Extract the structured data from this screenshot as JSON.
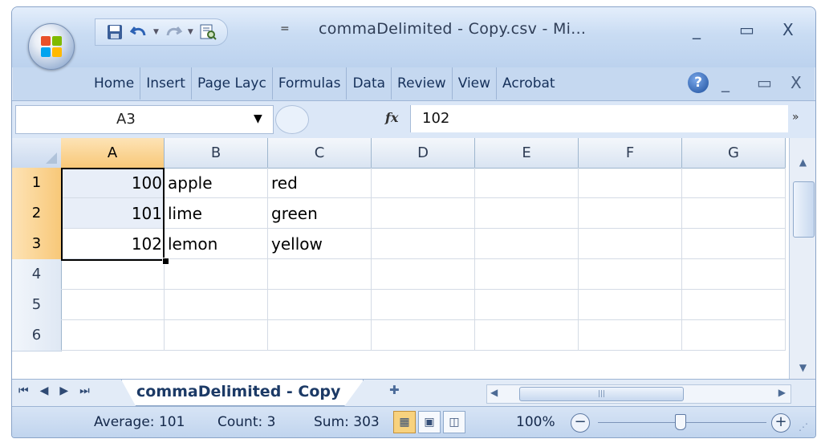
{
  "window": {
    "title": "commaDelimited - Copy.csv - Mi...",
    "minimize": "_",
    "restore": "▭",
    "close": "X"
  },
  "quick_access": {
    "more": "="
  },
  "menubar": {
    "items": [
      "Home",
      "Insert",
      "Page Layc",
      "Formulas",
      "Data",
      "Review",
      "View",
      "Acrobat"
    ],
    "help": "?",
    "minimize": "_",
    "restore": "▭",
    "close": "X"
  },
  "formula_bar": {
    "name_box": "A3",
    "fx_label": "fx",
    "value": "102"
  },
  "sheet": {
    "columns": [
      "A",
      "B",
      "C",
      "D",
      "E",
      "F",
      "G"
    ],
    "rows": [
      "1",
      "2",
      "3",
      "4",
      "5",
      "6"
    ],
    "cells": [
      [
        "100",
        "apple",
        "red",
        "",
        "",
        "",
        ""
      ],
      [
        "101",
        "lime",
        "green",
        "",
        "",
        "",
        ""
      ],
      [
        "102",
        "lemon",
        "yellow",
        "",
        "",
        "",
        ""
      ],
      [
        "",
        "",
        "",
        "",
        "",
        "",
        ""
      ],
      [
        "",
        "",
        "",
        "",
        "",
        "",
        ""
      ],
      [
        "",
        "",
        "",
        "",
        "",
        "",
        ""
      ]
    ],
    "active_cell": "A3"
  },
  "tabs": {
    "sheet_name": "commaDelimited - Copy"
  },
  "status": {
    "average": "Average: 101",
    "count": "Count: 3",
    "sum": "Sum: 303",
    "zoom": "100%",
    "zoom_level": 1.0
  },
  "colors": {
    "selection_header": "#f8c878",
    "chrome_blue": "#c5d8f0"
  }
}
